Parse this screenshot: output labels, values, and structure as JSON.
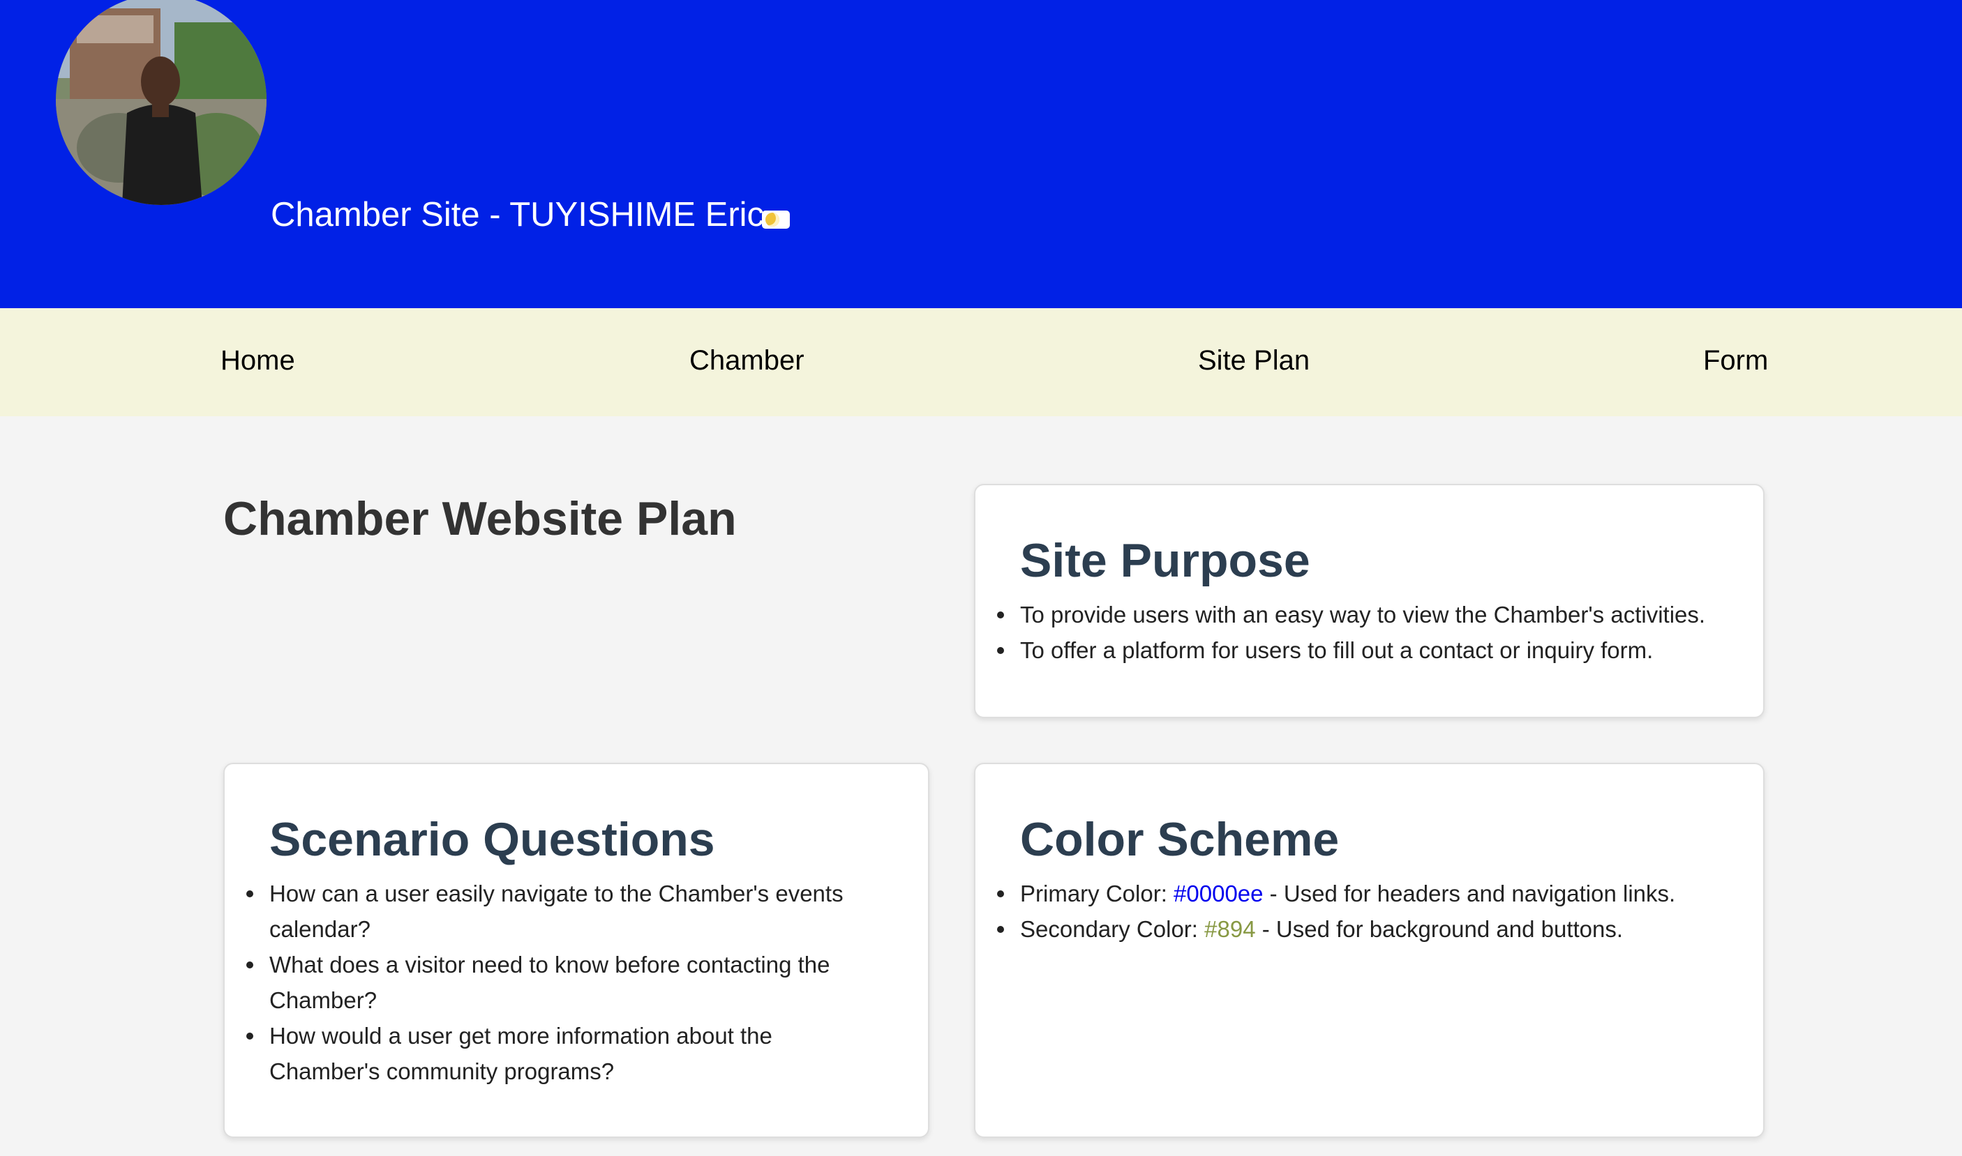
{
  "header": {
    "title": "Chamber Site - TUYISHIME Eric",
    "avatar_alt": "Profile photo",
    "toggle_icon": "moon-icon",
    "background": "#0121e6"
  },
  "nav": {
    "items": [
      {
        "label": "Home"
      },
      {
        "label": "Chamber"
      },
      {
        "label": "Site Plan"
      },
      {
        "label": "Form"
      }
    ],
    "background": "#f4f4dc"
  },
  "main": {
    "heading": "Chamber Website Plan",
    "site_purpose": {
      "title": "Site Purpose",
      "items": [
        "To provide users with an easy way to view the Chamber's activities.",
        "To offer a platform for users to fill out a contact or inquiry form."
      ]
    },
    "scenario_questions": {
      "title": "Scenario Questions",
      "items": [
        "How can a user easily navigate to the Chamber's events calendar?",
        "What does a visitor need to know before contacting the Chamber?",
        "How would a user get more information about the Chamber's community programs?"
      ]
    },
    "color_scheme": {
      "title": "Color Scheme",
      "primary": {
        "label": "Primary Color: ",
        "value": "#0000ee",
        "description": " - Used for headers and navigation links."
      },
      "secondary": {
        "label": "Secondary Color: ",
        "value": "#894",
        "description": " - Used for background and buttons."
      }
    }
  }
}
